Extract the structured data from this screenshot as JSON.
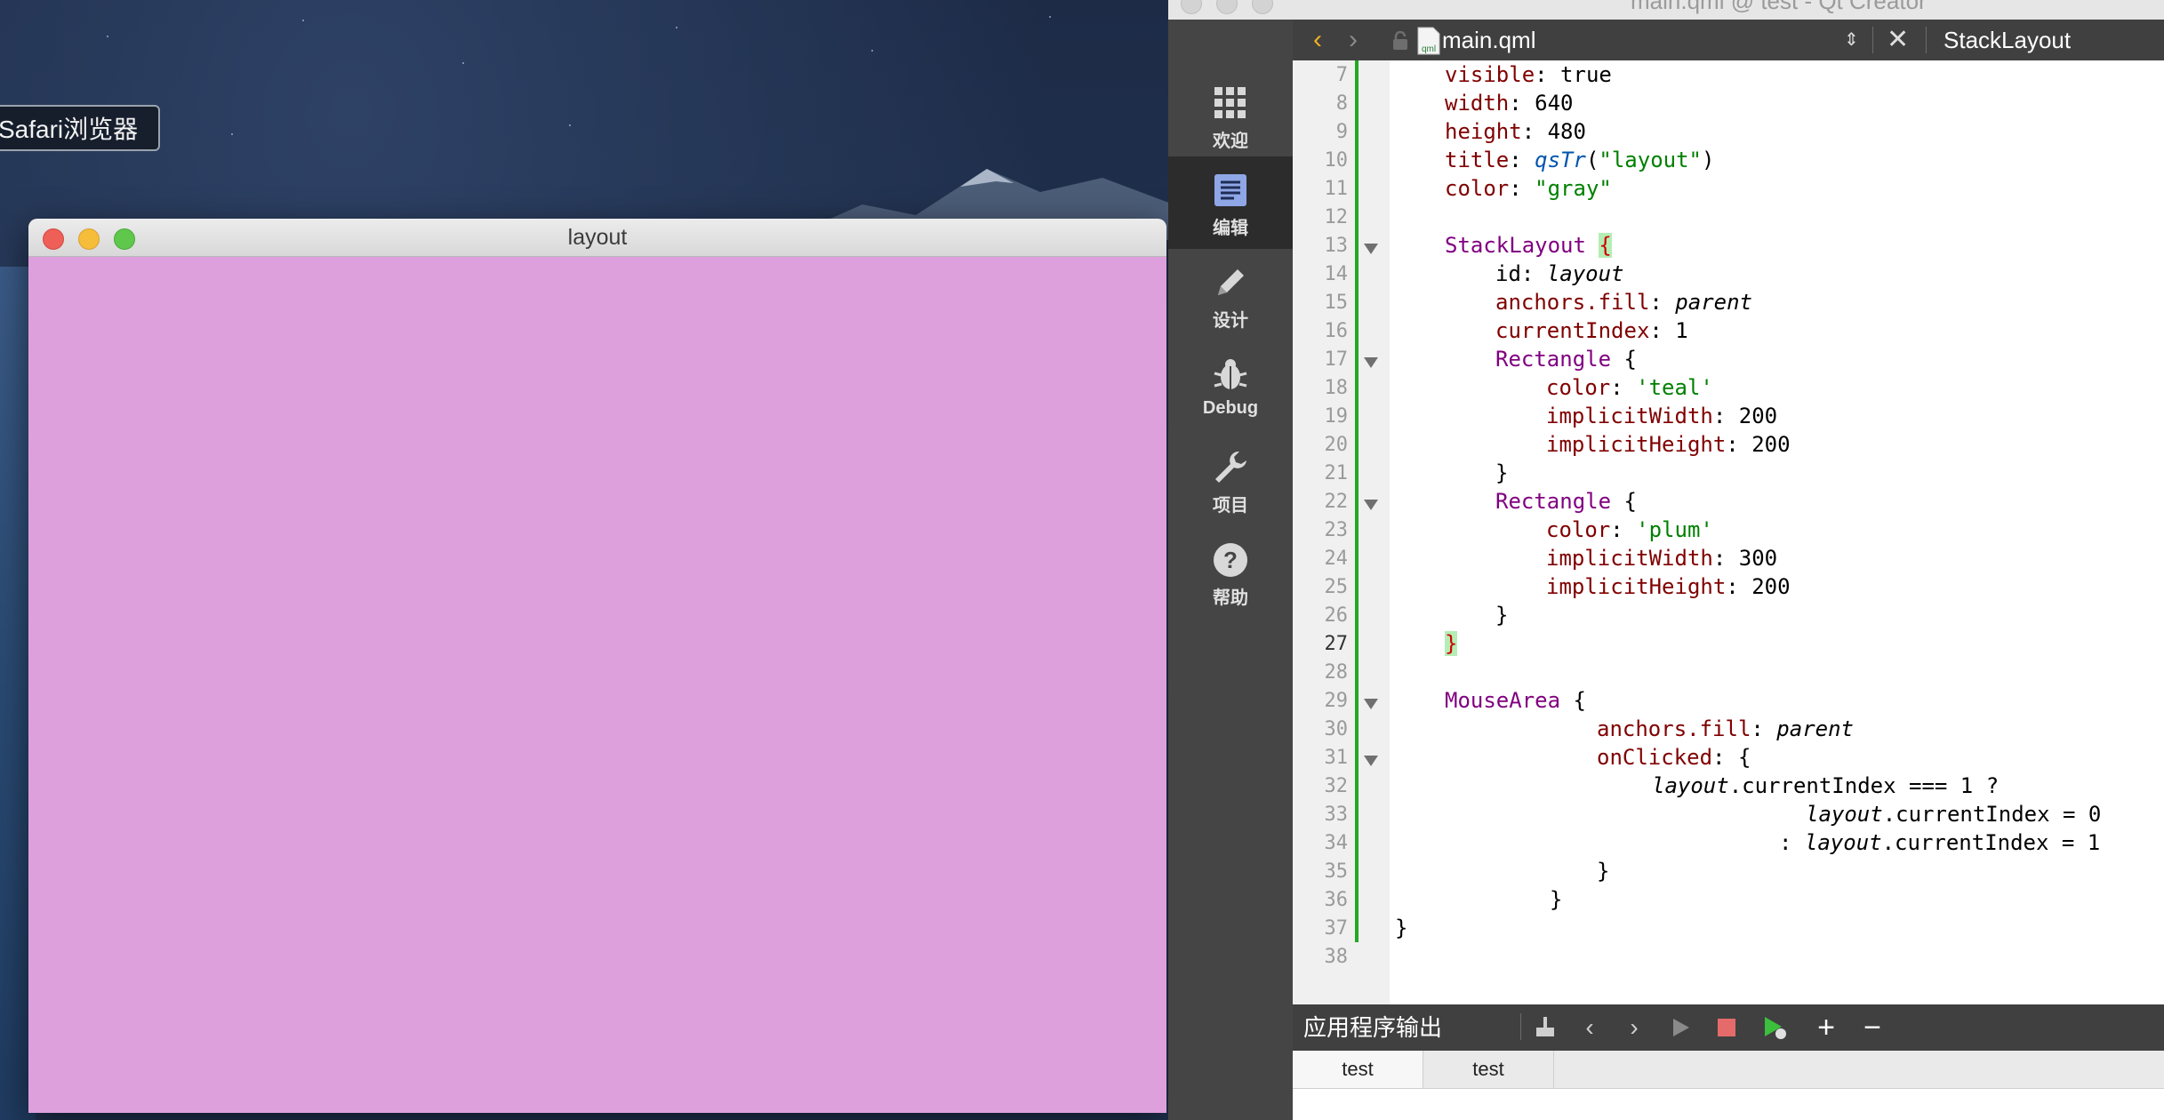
{
  "desktop": {
    "tooltip": "Safari浏览器"
  },
  "app_window": {
    "title": "layout",
    "content_color": "#dda0dd"
  },
  "qt_creator": {
    "window_title": "main.qml @ test - Qt Creator",
    "modes": [
      {
        "label": "欢迎",
        "icon": "grid-icon"
      },
      {
        "label": "编辑",
        "icon": "document-icon",
        "active": true
      },
      {
        "label": "设计",
        "icon": "pencil-icon"
      },
      {
        "label": "Debug",
        "icon": "bug-icon"
      },
      {
        "label": "项目",
        "icon": "wrench-icon"
      },
      {
        "label": "帮助",
        "icon": "help-icon"
      }
    ],
    "toolbar": {
      "back": "‹",
      "forward": "›",
      "file_name": "main.qml",
      "combo_arrows": "⇕",
      "close": "✕",
      "symbol": "StackLayout"
    },
    "current_line": 27,
    "line_numbers": [
      "7",
      "8",
      "9",
      "10",
      "11",
      "12",
      "13",
      "14",
      "15",
      "16",
      "17",
      "18",
      "19",
      "20",
      "21",
      "22",
      "23",
      "24",
      "25",
      "26",
      "27",
      "28",
      "29",
      "30",
      "31",
      "32",
      "33",
      "34",
      "35",
      "36",
      "37",
      "38"
    ],
    "code": {
      "l7": [
        "visible",
        ": true"
      ],
      "l8": [
        "width",
        ": 640"
      ],
      "l9": [
        "height",
        ": 480"
      ],
      "l10": [
        "title",
        ": ",
        "qsTr",
        "(",
        "\"layout\"",
        ")"
      ],
      "l11": [
        "color",
        ": ",
        "\"gray\""
      ],
      "l13": [
        "StackLayout",
        " ",
        "{"
      ],
      "l14": [
        "id: ",
        "layout"
      ],
      "l15": [
        "anchors.fill",
        ": ",
        "parent"
      ],
      "l16": [
        "currentIndex",
        ": 1"
      ],
      "l17": [
        "Rectangle",
        " {"
      ],
      "l18": [
        "color",
        ": ",
        "'teal'"
      ],
      "l19": [
        "implicitWidth",
        ": 200"
      ],
      "l20": [
        "implicitHeight",
        ": 200"
      ],
      "l21": [
        "}"
      ],
      "l22": [
        "Rectangle",
        " {"
      ],
      "l23": [
        "color",
        ": ",
        "'plum'"
      ],
      "l24": [
        "implicitWidth",
        ": 300"
      ],
      "l25": [
        "implicitHeight",
        ": 200"
      ],
      "l26": [
        "}"
      ],
      "l27": [
        "}"
      ],
      "l29": [
        "MouseArea",
        " {"
      ],
      "l30": [
        "anchors.fill",
        ": ",
        "parent"
      ],
      "l31": [
        "onClicked",
        ": {"
      ],
      "l32": [
        "layout",
        ".currentIndex === 1 ?"
      ],
      "l33": [
        "layout",
        ".currentIndex = 0"
      ],
      "l34": [
        ": ",
        "layout",
        ".currentIndex = 1"
      ],
      "l35": [
        "}"
      ],
      "l36": [
        "}"
      ],
      "l37": [
        "}"
      ]
    },
    "output": {
      "title": "应用程序输出",
      "tabs": [
        "test",
        "test"
      ]
    },
    "colors": {
      "property": "#800000",
      "type": "#800080",
      "string": "#008000",
      "function": "#0055af",
      "change_bar": "#23a823"
    }
  }
}
